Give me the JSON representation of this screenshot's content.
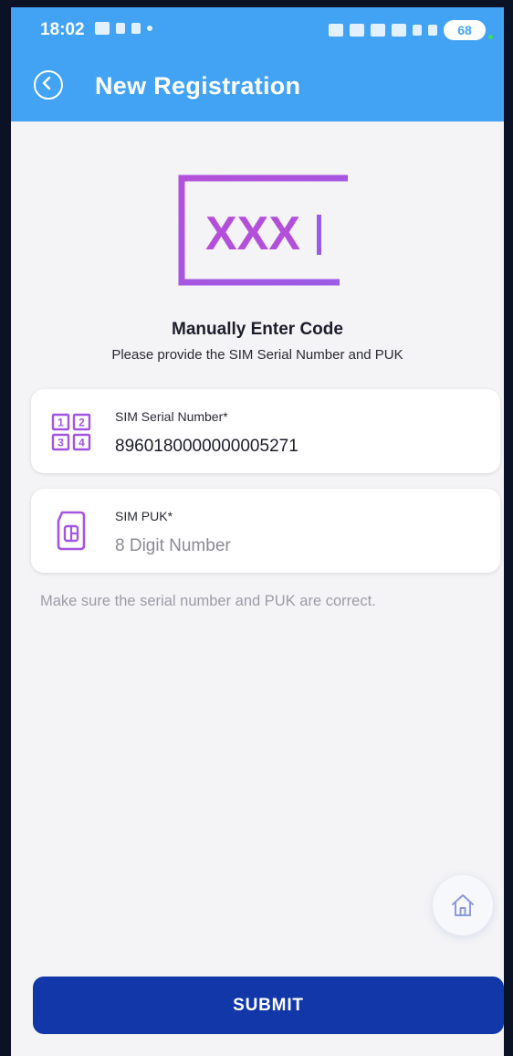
{
  "status_bar": {
    "time": "18:02",
    "battery": "68"
  },
  "header": {
    "title": "New Registration"
  },
  "logo": {
    "text": "XXX"
  },
  "main": {
    "heading": "Manually Enter Code",
    "subheading": "Please provide the SIM Serial Number and PUK",
    "serial_field": {
      "label": "SIM Serial Number*",
      "value": "8960180000000005271",
      "icon": "numbered-grid-icon"
    },
    "puk_field": {
      "label": "SIM PUK*",
      "placeholder": "8 Digit Number",
      "icon": "sim-card-icon"
    },
    "hint": "Make sure the serial number and PUK are correct."
  },
  "home_button": {
    "icon": "home-icon"
  },
  "submit_label": "SUBMIT",
  "colors": {
    "appbar": "#42a3f5",
    "accent_purple": "#a455e0",
    "submit": "#1237a8"
  }
}
